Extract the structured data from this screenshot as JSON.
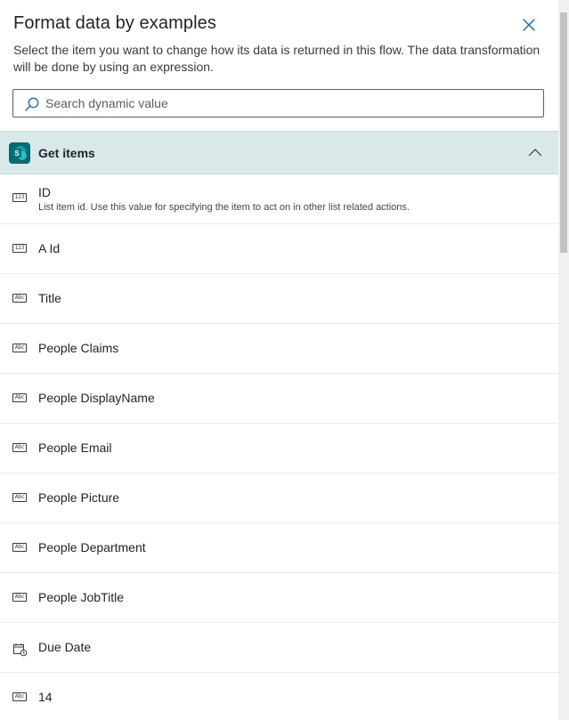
{
  "panel": {
    "title": "Format data by examples",
    "description": "Select the item you want to change how its data is returned in this flow. The data transformation will be done by using an expression.",
    "close_icon": "close-icon"
  },
  "search": {
    "placeholder": "Search dynamic value",
    "value": "",
    "icon": "search-icon"
  },
  "group": {
    "title": "Get items",
    "icon": "sharepoint-icon",
    "logo_text": "S",
    "expanded": true,
    "chevron_icon": "chevron-up-icon",
    "background": "#d9e8e8"
  },
  "items": [
    {
      "label": "ID",
      "type": "123",
      "icon": "number-icon",
      "description": "List item id. Use this value for specifying the item to act on in other list related actions."
    },
    {
      "label": "A Id",
      "type": "123",
      "icon": "number-icon",
      "description": ""
    },
    {
      "label": "Title",
      "type": "Abc",
      "icon": "text-icon",
      "description": ""
    },
    {
      "label": "People Claims",
      "type": "Abc",
      "icon": "text-icon",
      "description": ""
    },
    {
      "label": "People DisplayName",
      "type": "Abc",
      "icon": "text-icon",
      "description": ""
    },
    {
      "label": "People Email",
      "type": "Abc",
      "icon": "text-icon",
      "description": ""
    },
    {
      "label": "People Picture",
      "type": "Abc",
      "icon": "text-icon",
      "description": ""
    },
    {
      "label": "People Department",
      "type": "Abc",
      "icon": "text-icon",
      "description": ""
    },
    {
      "label": "People JobTitle",
      "type": "Abc",
      "icon": "text-icon",
      "description": ""
    },
    {
      "label": "Due Date",
      "type": "date",
      "icon": "calendar-icon",
      "description": ""
    },
    {
      "label": "14",
      "type": "Abc",
      "icon": "text-icon",
      "description": ""
    }
  ],
  "colors": {
    "accent": "#0f6cbd",
    "sharepoint": "#036c70",
    "divider": "#edebe9"
  }
}
